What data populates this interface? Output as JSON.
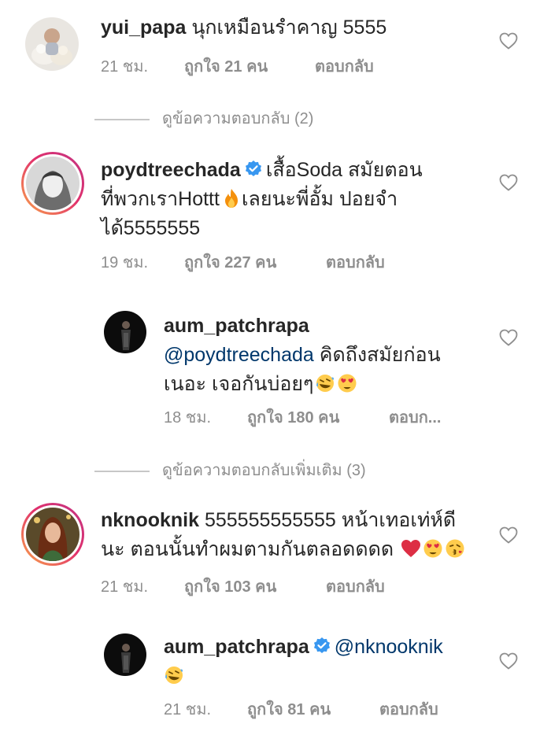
{
  "comments": [
    {
      "username": "yui_papa",
      "text": "นุกเหมือนรำคาญ 5555",
      "time": "21 ชม.",
      "likes": "ถูกใจ 21 คน",
      "reply": "ตอบกลับ"
    },
    {
      "username": "poydtreechada",
      "text_line1": "เสื้อSoda สมัยตอน",
      "text_line2a": "ที่พวกเราHottt",
      "text_line2b": "เลยนะพี่อั้ม ปอยจำ",
      "text_line3": "ได้5555555",
      "time": "19 ชม.",
      "likes": "ถูกใจ 227 คน",
      "reply": "ตอบกลับ"
    },
    {
      "username": "aum_patchrapa",
      "mention": "@poydtreechada",
      "text_line1": "คิดถึงสมัยก่อน",
      "text_line2": "เนอะ เจอกันบ่อยๆ",
      "time": "18 ชม.",
      "likes": "ถูกใจ 180 คน",
      "reply": "ตอบก..."
    },
    {
      "username": "nknooknik",
      "text_line1": "555555555555 หน้าเทอเท่ห์ดี",
      "text_line2": "นะ ตอนนั้นทำผมตามกันตลอดดดด",
      "time": "21 ชม.",
      "likes": "ถูกใจ 103 คน",
      "reply": "ตอบกลับ"
    },
    {
      "username": "aum_patchrapa",
      "mention": "@nknooknik",
      "time": "21 ชม.",
      "likes": "ถูกใจ 81 คน",
      "reply": "ตอบกลับ"
    }
  ],
  "view_replies_1": "ดูข้อความตอบกลับ (2)",
  "view_replies_2": "ดูข้อความตอบกลับเพิ่มเติม (3)",
  "colors": {
    "text": "#262626",
    "meta": "#8e8e8e",
    "mention": "#00376b",
    "verified": "#3897f0",
    "story_ring": "#e1306c"
  },
  "icons": [
    "heart-outline-icon",
    "verified-badge-icon",
    "fire-emoji",
    "rofl-emoji",
    "heart-eyes-emoji",
    "red-heart-emoji",
    "kissing-emoji"
  ]
}
